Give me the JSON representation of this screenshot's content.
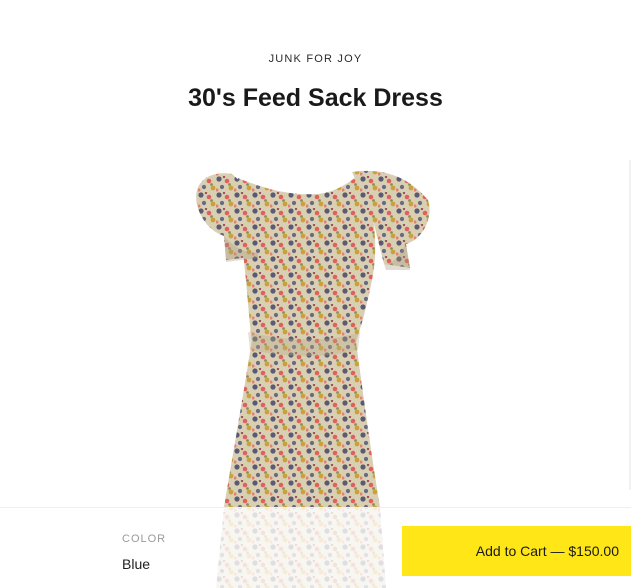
{
  "product": {
    "vendor": "JUNK FOR JOY",
    "title": "30's Feed Sack Dress"
  },
  "image": {
    "icon": "floral-dress-photo"
  },
  "purchase_bar": {
    "color_label": "COLOR",
    "color_value": "Blue",
    "add_to_cart_label": "Add to Cart — $150.00",
    "button_color": "#ffe617"
  }
}
